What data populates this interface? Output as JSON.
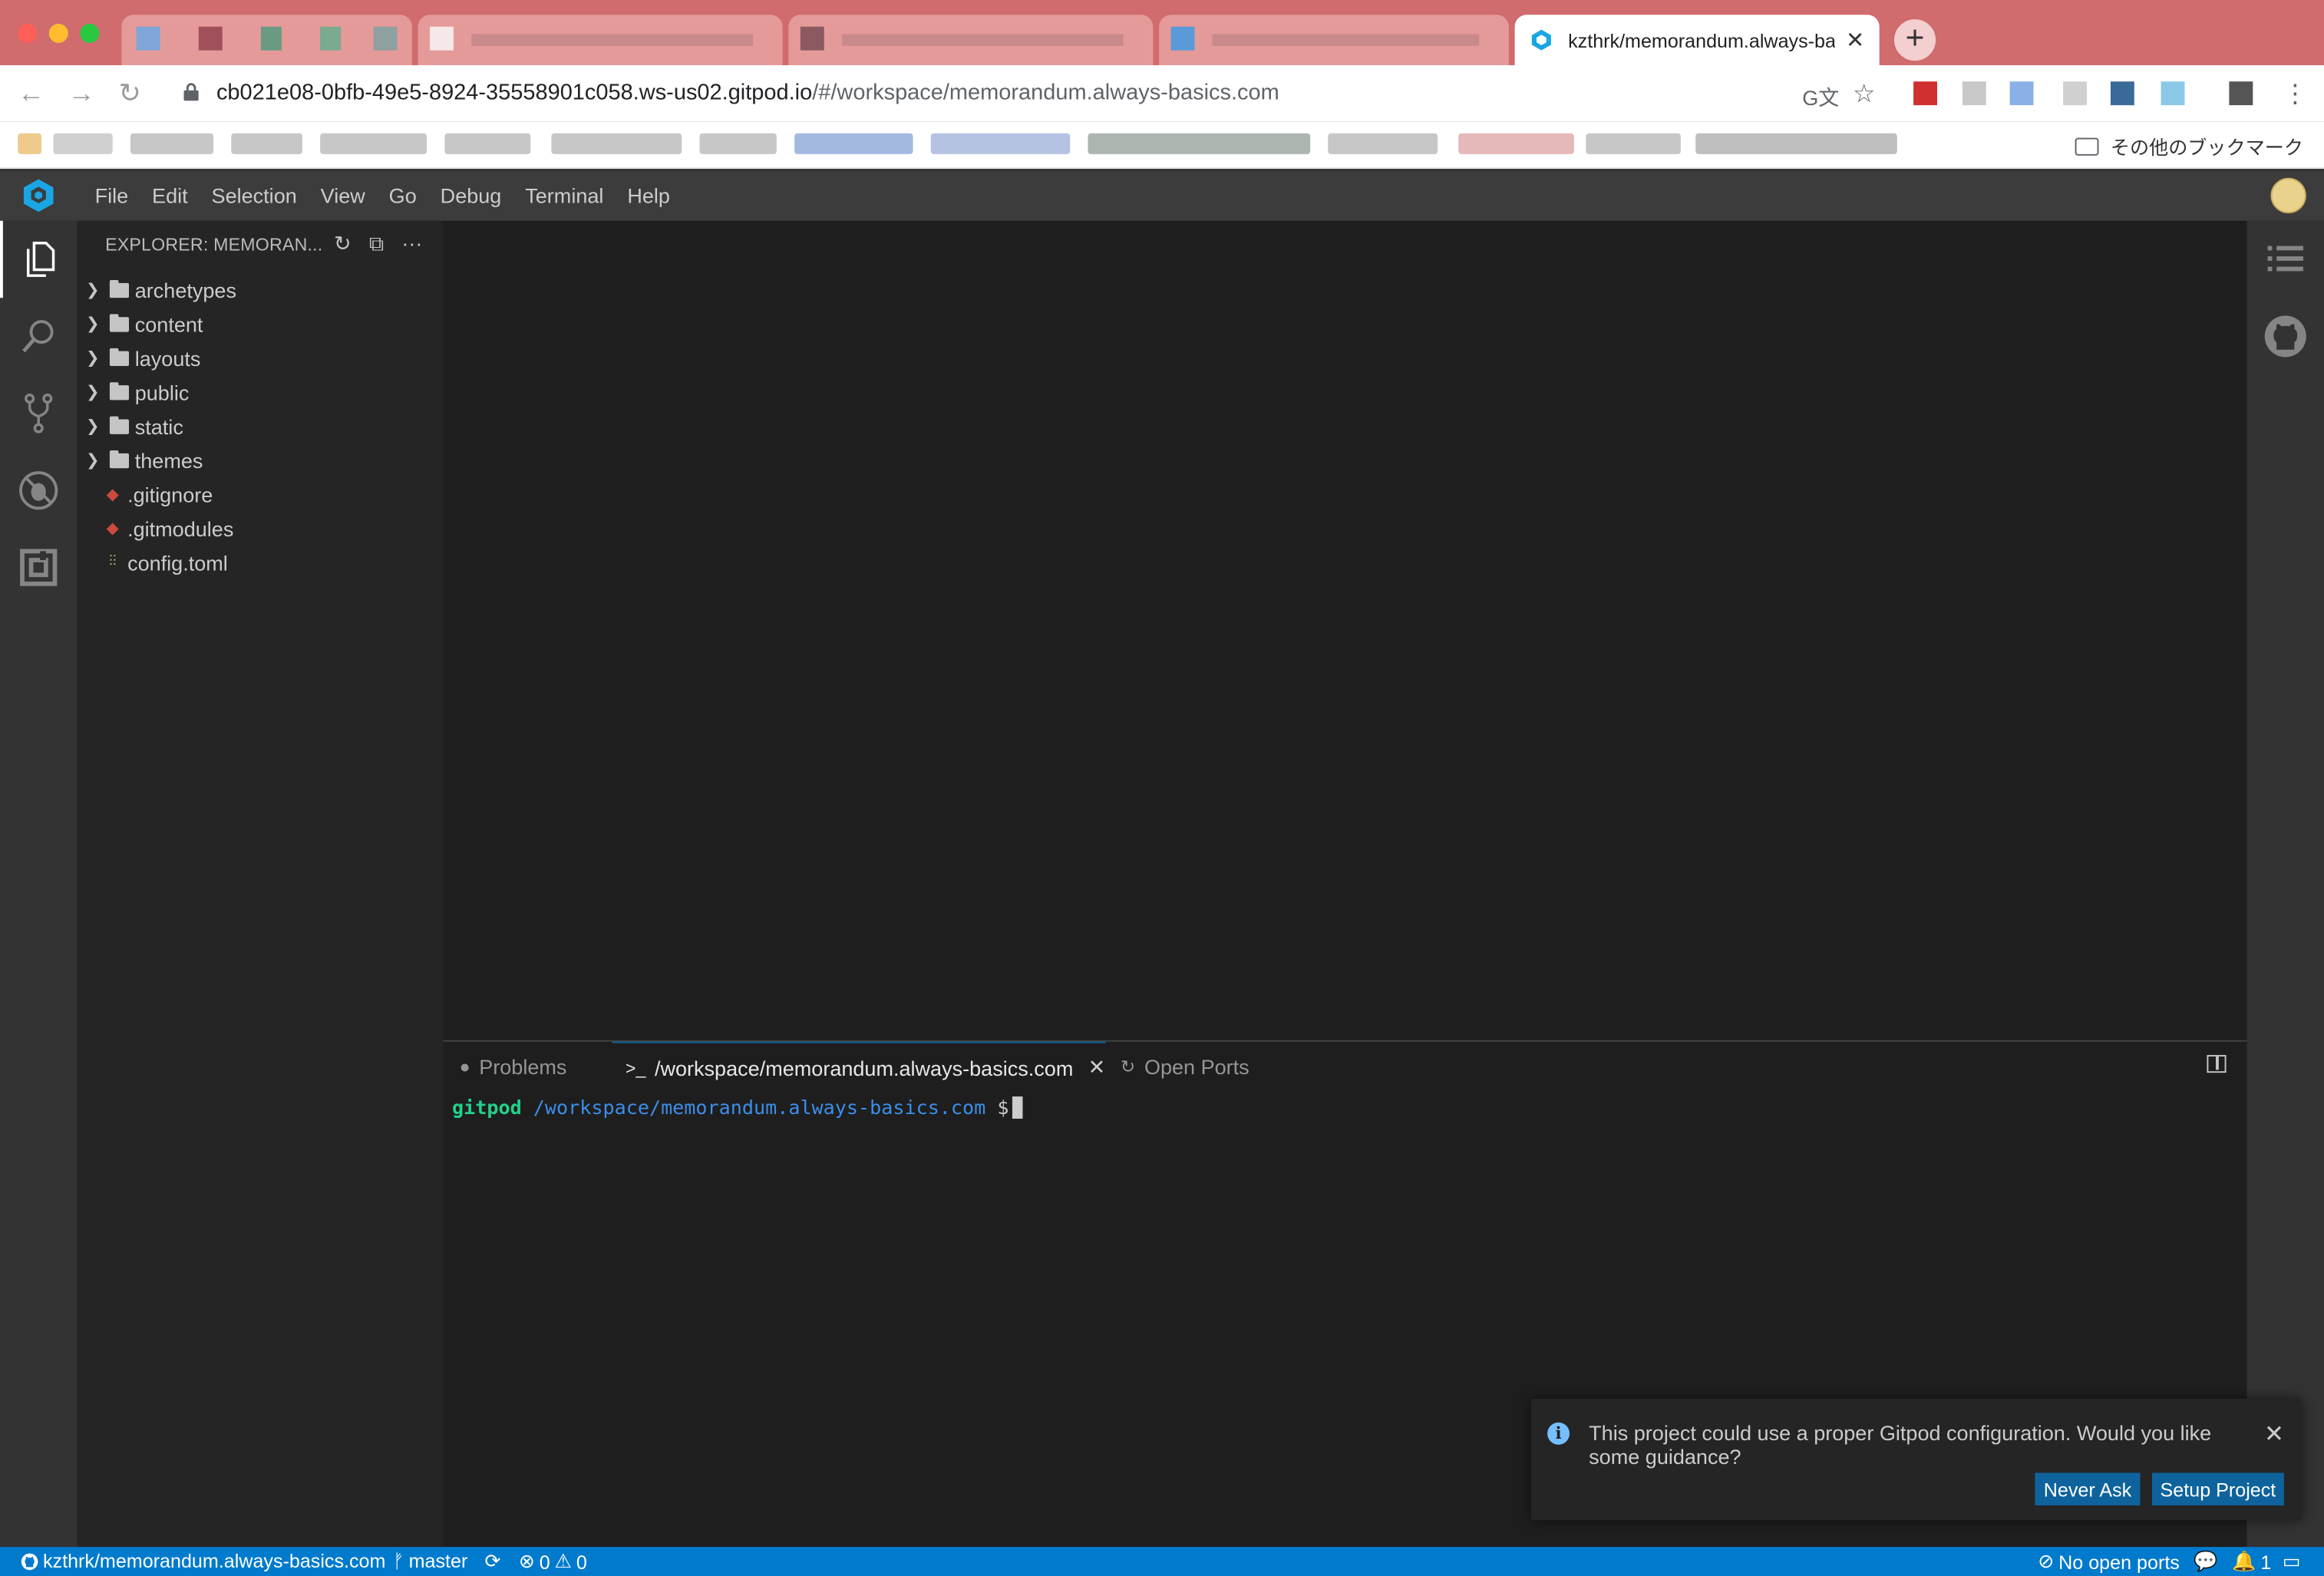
{
  "browser": {
    "active_tab_title": "kzthrk/memorandum.always-basics.com",
    "url_host": "cb021e08-0bfb-49e5-8924-35558901c058.ws-us02.gitpod.io",
    "url_path": "/#/workspace/memorandum.always-basics.com",
    "other_bookmarks_label": "その他のブックマーク"
  },
  "menubar": {
    "items": [
      "File",
      "Edit",
      "Selection",
      "View",
      "Go",
      "Debug",
      "Terminal",
      "Help"
    ]
  },
  "explorer": {
    "title": "EXPLORER: MEMORAN...",
    "folders": [
      "archetypes",
      "content",
      "layouts",
      "public",
      "static",
      "themes"
    ],
    "files": [
      ".gitignore",
      ".gitmodules",
      "config.toml"
    ]
  },
  "panel": {
    "tabs": [
      "Problems",
      "/workspace/memorandum.always-basics.com",
      "Open Ports"
    ],
    "terminal": {
      "user": "gitpod",
      "cwd": "/workspace/memorandum.always-basics.com",
      "prompt": "$"
    }
  },
  "notification": {
    "message": "This project could use a proper Gitpod configuration. Would you like some guidance?",
    "never_ask": "Never Ask",
    "setup_project": "Setup Project"
  },
  "statusbar": {
    "repo": "kzthrk/memorandum.always-basics.com",
    "branch": "master",
    "errors": "0",
    "warnings": "0",
    "ports": "No open ports",
    "notifications": "1"
  },
  "colors": {
    "accent": "#007acc",
    "button": "#0e639c",
    "terminal_user": "#23d18b",
    "terminal_cwd": "#3b8eea"
  }
}
